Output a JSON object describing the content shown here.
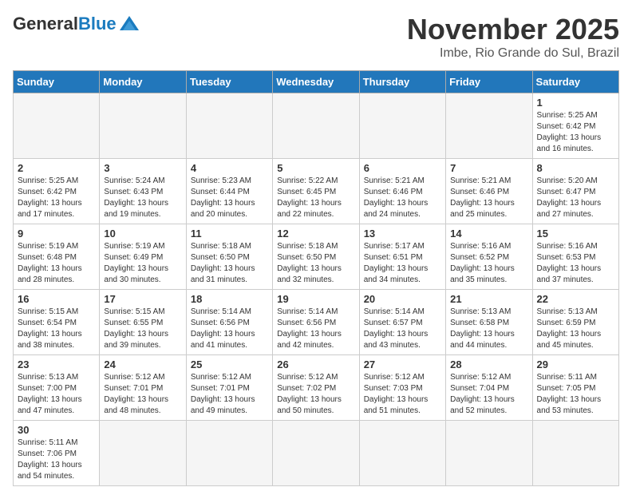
{
  "header": {
    "logo_general": "General",
    "logo_blue": "Blue",
    "month_title": "November 2025",
    "location": "Imbe, Rio Grande do Sul, Brazil"
  },
  "weekdays": [
    "Sunday",
    "Monday",
    "Tuesday",
    "Wednesday",
    "Thursday",
    "Friday",
    "Saturday"
  ],
  "days": {
    "d1": {
      "num": "1",
      "sunrise": "5:25 AM",
      "sunset": "6:42 PM",
      "daylight": "13 hours and 16 minutes."
    },
    "d2": {
      "num": "2",
      "sunrise": "5:25 AM",
      "sunset": "6:42 PM",
      "daylight": "13 hours and 17 minutes."
    },
    "d3": {
      "num": "3",
      "sunrise": "5:24 AM",
      "sunset": "6:43 PM",
      "daylight": "13 hours and 19 minutes."
    },
    "d4": {
      "num": "4",
      "sunrise": "5:23 AM",
      "sunset": "6:44 PM",
      "daylight": "13 hours and 20 minutes."
    },
    "d5": {
      "num": "5",
      "sunrise": "5:22 AM",
      "sunset": "6:45 PM",
      "daylight": "13 hours and 22 minutes."
    },
    "d6": {
      "num": "6",
      "sunrise": "5:21 AM",
      "sunset": "6:46 PM",
      "daylight": "13 hours and 24 minutes."
    },
    "d7": {
      "num": "7",
      "sunrise": "5:21 AM",
      "sunset": "6:46 PM",
      "daylight": "13 hours and 25 minutes."
    },
    "d8": {
      "num": "8",
      "sunrise": "5:20 AM",
      "sunset": "6:47 PM",
      "daylight": "13 hours and 27 minutes."
    },
    "d9": {
      "num": "9",
      "sunrise": "5:19 AM",
      "sunset": "6:48 PM",
      "daylight": "13 hours and 28 minutes."
    },
    "d10": {
      "num": "10",
      "sunrise": "5:19 AM",
      "sunset": "6:49 PM",
      "daylight": "13 hours and 30 minutes."
    },
    "d11": {
      "num": "11",
      "sunrise": "5:18 AM",
      "sunset": "6:50 PM",
      "daylight": "13 hours and 31 minutes."
    },
    "d12": {
      "num": "12",
      "sunrise": "5:18 AM",
      "sunset": "6:50 PM",
      "daylight": "13 hours and 32 minutes."
    },
    "d13": {
      "num": "13",
      "sunrise": "5:17 AM",
      "sunset": "6:51 PM",
      "daylight": "13 hours and 34 minutes."
    },
    "d14": {
      "num": "14",
      "sunrise": "5:16 AM",
      "sunset": "6:52 PM",
      "daylight": "13 hours and 35 minutes."
    },
    "d15": {
      "num": "15",
      "sunrise": "5:16 AM",
      "sunset": "6:53 PM",
      "daylight": "13 hours and 37 minutes."
    },
    "d16": {
      "num": "16",
      "sunrise": "5:15 AM",
      "sunset": "6:54 PM",
      "daylight": "13 hours and 38 minutes."
    },
    "d17": {
      "num": "17",
      "sunrise": "5:15 AM",
      "sunset": "6:55 PM",
      "daylight": "13 hours and 39 minutes."
    },
    "d18": {
      "num": "18",
      "sunrise": "5:14 AM",
      "sunset": "6:56 PM",
      "daylight": "13 hours and 41 minutes."
    },
    "d19": {
      "num": "19",
      "sunrise": "5:14 AM",
      "sunset": "6:56 PM",
      "daylight": "13 hours and 42 minutes."
    },
    "d20": {
      "num": "20",
      "sunrise": "5:14 AM",
      "sunset": "6:57 PM",
      "daylight": "13 hours and 43 minutes."
    },
    "d21": {
      "num": "21",
      "sunrise": "5:13 AM",
      "sunset": "6:58 PM",
      "daylight": "13 hours and 44 minutes."
    },
    "d22": {
      "num": "22",
      "sunrise": "5:13 AM",
      "sunset": "6:59 PM",
      "daylight": "13 hours and 45 minutes."
    },
    "d23": {
      "num": "23",
      "sunrise": "5:13 AM",
      "sunset": "7:00 PM",
      "daylight": "13 hours and 47 minutes."
    },
    "d24": {
      "num": "24",
      "sunrise": "5:12 AM",
      "sunset": "7:01 PM",
      "daylight": "13 hours and 48 minutes."
    },
    "d25": {
      "num": "25",
      "sunrise": "5:12 AM",
      "sunset": "7:01 PM",
      "daylight": "13 hours and 49 minutes."
    },
    "d26": {
      "num": "26",
      "sunrise": "5:12 AM",
      "sunset": "7:02 PM",
      "daylight": "13 hours and 50 minutes."
    },
    "d27": {
      "num": "27",
      "sunrise": "5:12 AM",
      "sunset": "7:03 PM",
      "daylight": "13 hours and 51 minutes."
    },
    "d28": {
      "num": "28",
      "sunrise": "5:12 AM",
      "sunset": "7:04 PM",
      "daylight": "13 hours and 52 minutes."
    },
    "d29": {
      "num": "29",
      "sunrise": "5:11 AM",
      "sunset": "7:05 PM",
      "daylight": "13 hours and 53 minutes."
    },
    "d30": {
      "num": "30",
      "sunrise": "5:11 AM",
      "sunset": "7:06 PM",
      "daylight": "13 hours and 54 minutes."
    }
  },
  "labels": {
    "sunrise": "Sunrise:",
    "sunset": "Sunset:",
    "daylight": "Daylight:"
  }
}
